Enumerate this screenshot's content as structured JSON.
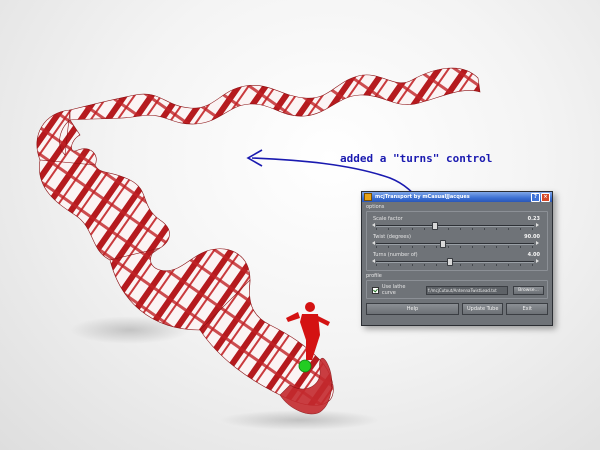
{
  "annotation": {
    "text": "added a \"turns\" control"
  },
  "dialog": {
    "title": "mcjTransport by mCasualJJacques",
    "options_label": "options",
    "sliders": [
      {
        "label": "Scale factor",
        "value": "0.23",
        "position": 0.37
      },
      {
        "label": "Twist (degrees)",
        "value": "90.00",
        "position": 0.42
      },
      {
        "label": "Turns (number of)",
        "value": "4.00",
        "position": 0.46
      }
    ],
    "profile_label": "profile",
    "lathe_label": "Use lathe curve",
    "lathe_path": "f:/mcjCutout/AntennaTwistLead.txt",
    "browse_label": "Browse...",
    "help_label": "Help",
    "update_label": "Update Tube",
    "exit_label": "Exit"
  },
  "colors": {
    "ribbon_red": "#b51a1e",
    "ribbon_white": "#fafafa",
    "figure_red": "#d41212",
    "handle_green": "#22cc22",
    "arrow_blue": "#1a1ab0"
  }
}
